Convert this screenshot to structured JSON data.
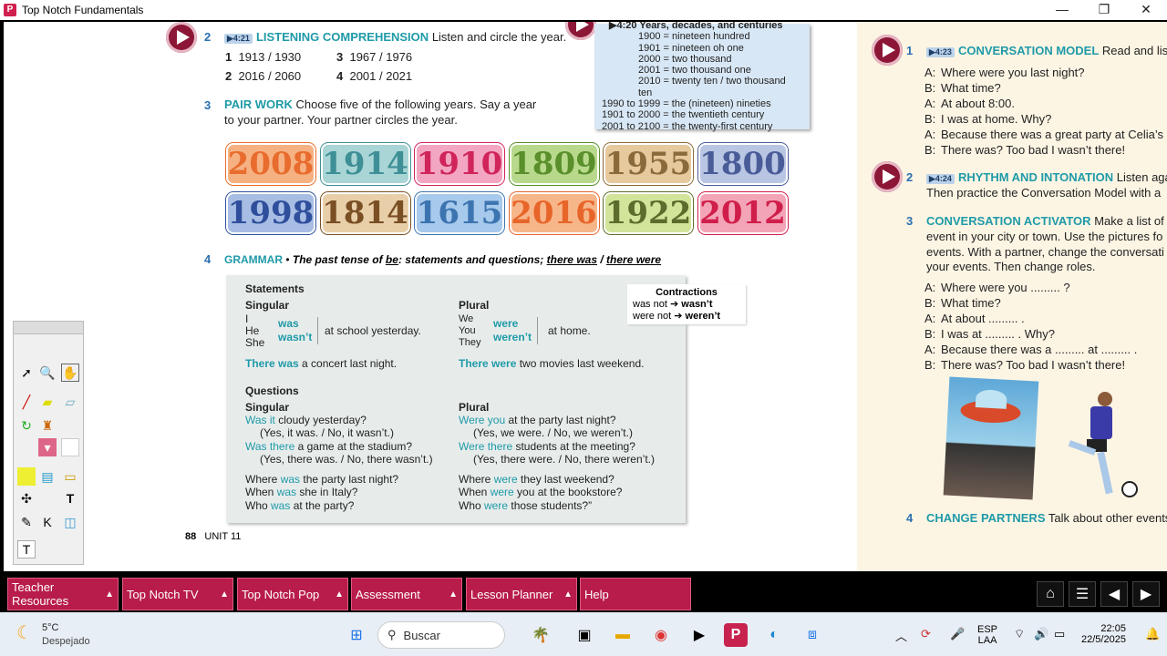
{
  "window": {
    "title": "Top Notch Fundamentals",
    "minimize": "—",
    "maximize": "❐",
    "close": "✕"
  },
  "section2": {
    "num": "2",
    "badge": "▶4:21",
    "heading": "LISTENING COMPREHENSION",
    "instruction": "Listen and circle the year.",
    "items": [
      {
        "n": "1",
        "text": "1913 / 1930"
      },
      {
        "n": "3",
        "text": "1967 / 1976"
      },
      {
        "n": "2",
        "text": "2016 / 2060"
      },
      {
        "n": "4",
        "text": "2001 / 2021"
      }
    ]
  },
  "section3": {
    "num": "3",
    "heading": "PAIR WORK",
    "line1": "Choose five of the following years. Say a year",
    "line2": "to your partner. Your partner circles the year.",
    "years": [
      {
        "label": "2008",
        "bg": "#f6b183",
        "fg": "#e86c2d"
      },
      {
        "label": "1914",
        "bg": "#a9d5d6",
        "fg": "#3e8f96"
      },
      {
        "label": "1910",
        "bg": "#f3a6c1",
        "fg": "#d0245b"
      },
      {
        "label": "1809",
        "bg": "#b8d98c",
        "fg": "#5a8f2c"
      },
      {
        "label": "1955",
        "bg": "#e7c99e",
        "fg": "#8a6a3a"
      },
      {
        "label": "1800",
        "bg": "#b9c6e3",
        "fg": "#4a5c98"
      },
      {
        "label": "1998",
        "bg": "#a8bde4",
        "fg": "#2f4f9c"
      },
      {
        "label": "1814",
        "bg": "#e8cfa9",
        "fg": "#7a4f24"
      },
      {
        "label": "1615",
        "bg": "#a7c9eb",
        "fg": "#3c74b0"
      },
      {
        "label": "2016",
        "bg": "#f7b68a",
        "fg": "#e8652a"
      },
      {
        "label": "1922",
        "bg": "#d2e39a",
        "fg": "#5b6c2c"
      },
      {
        "label": "2012",
        "bg": "#f4a4b7",
        "fg": "#d01e4a"
      }
    ]
  },
  "infobox": {
    "badge": "▶4:20",
    "title": "Years, decades, and centuries",
    "lines": [
      "1900 = nineteen hundred",
      "1901 = nineteen oh one",
      "2000 = two thousand",
      "2001 = two thousand one",
      "2010 = twenty ten / two thousand ten",
      "1990 to 1999 = the (nineteen) nineties",
      "1901 to 2000 = the twentieth century",
      "2001 to 2100 = the twenty-first century"
    ]
  },
  "section4": {
    "num": "4",
    "heading": "GRAMMAR",
    "bullet": "•",
    "title_pre": "The past tense of",
    "be": "be",
    "title_mid": ": statements and questions;",
    "there_was": "there was",
    "slash": "/",
    "there_were": "there were",
    "statements": "Statements",
    "singular": "Singular",
    "plural": "Plural",
    "sing_pronouns": [
      "I",
      "He",
      "She"
    ],
    "sing_verbs": [
      "was",
      "wasn’t"
    ],
    "sing_rest": "at school yesterday.",
    "plur_pronouns": [
      "We",
      "You",
      "They"
    ],
    "plur_verbs": [
      "were",
      "weren’t"
    ],
    "plur_rest": "at home.",
    "there_was_ex": "There was",
    "there_was_rest": "a concert last night.",
    "there_were_ex": "There were",
    "there_were_rest": "two movies last weekend.",
    "questions": "Questions",
    "q_sing": [
      {
        "hl": "Was it",
        "rest": " cloudy yesterday?"
      },
      {
        "hl": "",
        "rest": "(Yes, it was. / No, it wasn’t.)"
      },
      {
        "hl": "Was there",
        "rest": " a game at the stadium?"
      },
      {
        "hl": "",
        "rest": "(Yes, there was. / No, there wasn’t.)"
      }
    ],
    "q_plur": [
      {
        "hl": "Were you",
        "rest": " at the party last night?"
      },
      {
        "hl": "",
        "rest": "(Yes, we were. / No, we weren’t.)"
      },
      {
        "hl": "Were there",
        "rest": " students at the meeting?"
      },
      {
        "hl": "",
        "rest": "(Yes, there were. / No, there weren’t.)"
      }
    ],
    "wh_sing": [
      {
        "a": "Where ",
        "hl": "was",
        "b": " the party last night?"
      },
      {
        "a": "When ",
        "hl": "was",
        "b": " she in Italy?"
      },
      {
        "a": "Who ",
        "hl": "was",
        "b": " at the party?"
      }
    ],
    "wh_plur": [
      {
        "a": "Where ",
        "hl": "were",
        "b": " they last weekend?"
      },
      {
        "a": "When ",
        "hl": "were",
        "b": " you at the bookstore?"
      },
      {
        "a": "Who ",
        "hl": "were",
        "b": " those students?”"
      }
    ],
    "contractions": {
      "title": "Contractions",
      "r1a": "was not",
      "r1b": "wasn’t",
      "r2a": "were not",
      "r2b": "weren’t",
      "arrow": "➔"
    }
  },
  "footer": {
    "page": "88",
    "unit": "UNIT 11"
  },
  "right": {
    "s1": {
      "num": "1",
      "badge": "▶4:23",
      "heading": "CONVERSATION MODEL",
      "instr": "Read and listen",
      "lines": [
        {
          "s": "A:",
          "t": "Where were you last night?"
        },
        {
          "s": "B:",
          "t": "What time?"
        },
        {
          "s": "A:",
          "t": "At about 8:00."
        },
        {
          "s": "B:",
          "t": "I was at home. Why?"
        },
        {
          "s": "A:",
          "t": "Because there was a great party at Celia’s"
        },
        {
          "s": "B:",
          "t": "There was? Too bad I wasn’t there!"
        }
      ]
    },
    "s2": {
      "num": "2",
      "badge": "▶4:24",
      "heading": "RHYTHM AND INTONATION",
      "instr": "Listen again",
      "line2": "Then practice the Conversation Model with a"
    },
    "s3": {
      "num": "3",
      "heading": "CONVERSATION ACTIVATOR",
      "instr": "Make a list of plac",
      "body": [
        "event in your city or town. Use the pictures fo",
        "events. With a partner, change the conversati",
        "your events. Then change roles."
      ],
      "lines": [
        {
          "s": "A:",
          "t": "Where were you ......... ?"
        },
        {
          "s": "B:",
          "t": "What time?"
        },
        {
          "s": "A:",
          "t": "At about ......... ."
        },
        {
          "s": "B:",
          "t": "I was at ......... . Why?"
        },
        {
          "s": "A:",
          "t": "Because there was a ......... at ......... ."
        },
        {
          "s": "B:",
          "t": "There was? Too bad I wasn’t there!"
        }
      ]
    },
    "s4": {
      "num": "4",
      "heading": "CHANGE PARTNERS",
      "instr": "Talk about other events a"
    }
  },
  "nav": {
    "tabs": [
      "Teacher Resources",
      "Top Notch TV",
      "Top Notch Pop",
      "Assessment",
      "Lesson Planner",
      "Help"
    ],
    "arrow": "▲"
  },
  "taskbar": {
    "weather_temp": "5°C",
    "weather_desc": "Despejado",
    "search": "Buscar",
    "lang1": "ESP",
    "lang2": "LAA",
    "time": "22:05",
    "date": "22/5/2025"
  }
}
